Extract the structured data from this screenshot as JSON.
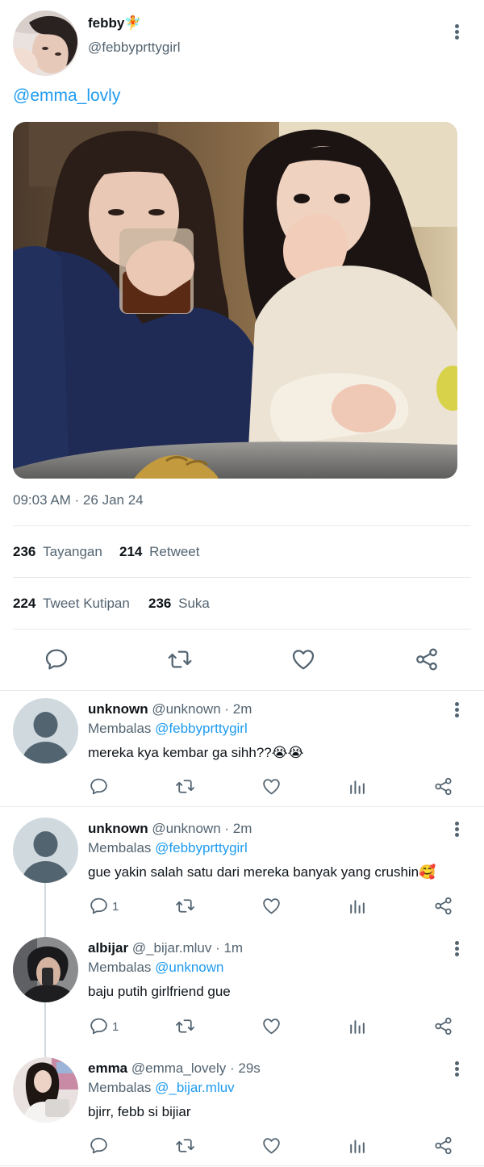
{
  "tweet": {
    "display_name": "febby🧚",
    "handle": "@febbyprttygirl",
    "body_mention": "@emma_lovly",
    "timestamp": "09:03 AM · 26 Jan 24",
    "stats": {
      "views_count": "236",
      "views_label": "Tayangan",
      "retweets_count": "214",
      "retweets_label": "Retweet",
      "quotes_count": "224",
      "quotes_label": "Tweet Kutipan",
      "likes_count": "236",
      "likes_label": "Suka"
    }
  },
  "replies": [
    {
      "name": "unknown",
      "meta": "@unknown · 2m",
      "replying_label": "Membalas",
      "replying_to": "@febbyprttygirl",
      "text": "mereka kya kembar ga sihh??😭😭",
      "reply_count": ""
    },
    {
      "name": "unknown",
      "meta": "@unknown · 2m",
      "replying_label": "Membalas",
      "replying_to": "@febbyprttygirl",
      "text": "gue yakin salah satu dari mereka banyak yang crushin🥰",
      "reply_count": "1"
    },
    {
      "name": "albijar",
      "meta": "@_bijar.mluv · 1m",
      "replying_label": "Membalas",
      "replying_to": "@unknown",
      "text": "baju putih girlfriend gue",
      "reply_count": "1"
    },
    {
      "name": "emma",
      "meta": "@emma_lovely · 29s",
      "replying_label": "Membalas",
      "replying_to": "@_bijar.mluv",
      "text": "bjirr, febb si bijiar",
      "reply_count": ""
    }
  ],
  "icons": {
    "reply": "comment-icon",
    "retweet": "retweet-icon",
    "like": "heart-icon",
    "share": "share-icon",
    "analytics": "analytics-icon",
    "more": "more-icon"
  },
  "colors": {
    "link": "#1d9bf0",
    "muted": "#536471",
    "text": "#0f1419",
    "divider": "#e6e9ec"
  }
}
